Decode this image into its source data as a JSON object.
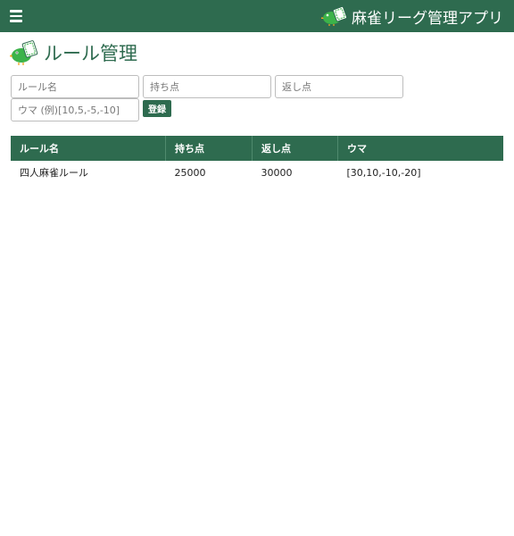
{
  "header": {
    "menu_icon": "hamburger-icon",
    "logo_icon": "bird-mahjong-icon",
    "app_title": "麻雀リーグ管理アプリ",
    "background": "#2e6b4f"
  },
  "page": {
    "icon": "bird-mahjong-icon",
    "title": "ルール管理"
  },
  "form": {
    "rule_name_placeholder": "ルール名",
    "start_points_placeholder": "持ち点",
    "return_points_placeholder": "返し点",
    "uma_placeholder": "ウマ (例)[10,5,-5,-10]",
    "submit_label": "登録"
  },
  "table": {
    "headers": [
      "ルール名",
      "持ち点",
      "返し点",
      "ウマ"
    ],
    "rows": [
      [
        "四人麻雀ルール",
        "25000",
        "30000",
        "[30,10,-10,-20]"
      ]
    ]
  },
  "colors": {
    "accent": "#2e6b4f",
    "bird": "#3cb34a"
  }
}
